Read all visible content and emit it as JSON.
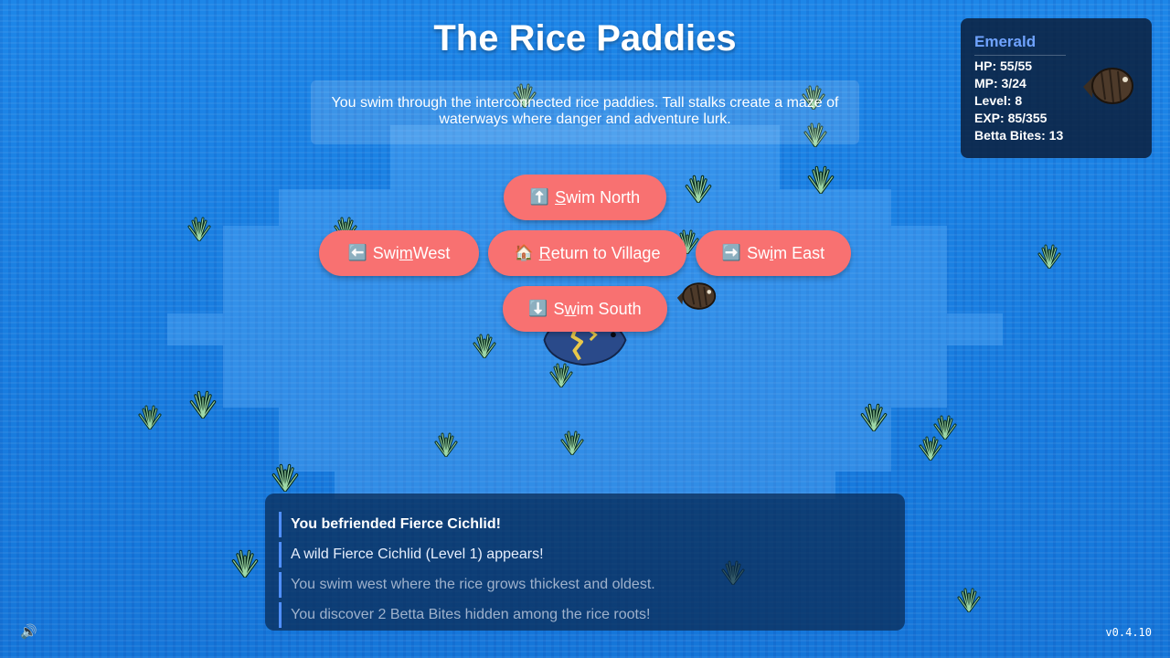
{
  "location": {
    "title": "The Rice Paddies",
    "description": "You swim through the interconnected rice paddies. Tall stalks create a maze of waterways where danger and adventure lurk."
  },
  "nav": {
    "north": {
      "icon": "⬆️",
      "pre": "",
      "key": "S",
      "post": "wim North"
    },
    "west": {
      "icon": "⬅️",
      "pre": "Swi",
      "key": "m",
      "post": " West"
    },
    "village": {
      "icon": "🏠",
      "pre": "",
      "key": "R",
      "post": "eturn to Village"
    },
    "east": {
      "icon": "➡️",
      "pre": "Sw",
      "key": "i",
      "post": "m East"
    },
    "south": {
      "icon": "⬇️",
      "pre": "S",
      "key": "w",
      "post": "im South"
    }
  },
  "player": {
    "name": "Emerald",
    "hp": "HP: 55/55",
    "mp": "MP: 3/24",
    "level": "Level: 8",
    "exp": "EXP: 85/355",
    "bites": "Betta Bites: 13"
  },
  "log": [
    "You befriended Fierce Cichlid!",
    "A wild Fierce Cichlid (Level 1) appears!",
    "You swim west where the rice grows thickest and oldest.",
    "You discover 2 Betta Bites hidden among the rice roots!"
  ],
  "version": "v0.4.10",
  "colors": {
    "water": "#1a7fe0",
    "button": "#f87171",
    "player_name": "#6fa3ff",
    "log_border": "#4f8fff"
  },
  "icons": {
    "sound": "speaker-icon",
    "player_fish": "betta-fish-icon",
    "enemy_fish": "cichlid-fish-icon",
    "rice": "rice-stalk-icon"
  }
}
